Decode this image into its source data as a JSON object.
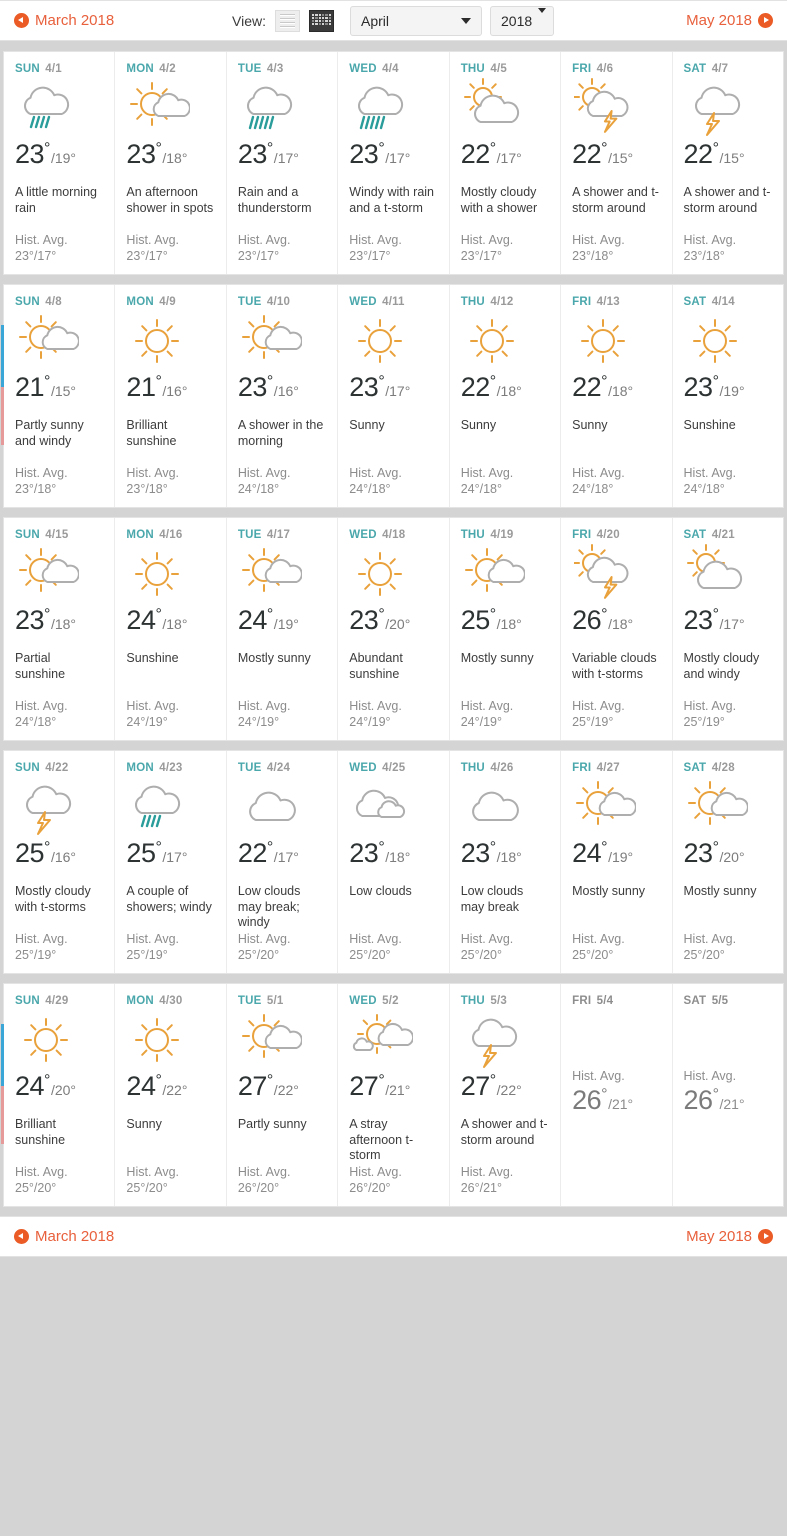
{
  "header": {
    "prev_label": "March 2018",
    "next_label": "May 2018",
    "view_label": "View:",
    "view_list_icon": "list-view-icon",
    "view_grid_icon": "calendar-grid-icon",
    "month_select": "April",
    "year_select": "2018",
    "accent_color": "#e8603c",
    "dayname_color": "#4aa7ab"
  },
  "footer": {
    "prev_label": "March 2018",
    "next_label": "May 2018"
  },
  "hist_prefix": "Hist. Avg.",
  "weeks": [
    {
      "marker": false,
      "days": [
        {
          "dow": "SUN",
          "date": "4/1",
          "icon": "rain",
          "hi": "23",
          "lo": "19",
          "phrase": "A little morning rain",
          "hist": "23°/17°",
          "active": true
        },
        {
          "dow": "MON",
          "date": "4/2",
          "icon": "sun-cloud",
          "hi": "23",
          "lo": "18",
          "phrase": "An afternoon shower in spots",
          "hist": "23°/17°",
          "active": true
        },
        {
          "dow": "TUE",
          "date": "4/3",
          "icon": "rain-heavy",
          "hi": "23",
          "lo": "17",
          "phrase": "Rain and a thunderstorm",
          "hist": "23°/17°",
          "active": true
        },
        {
          "dow": "WED",
          "date": "4/4",
          "icon": "rain-heavy",
          "hi": "23",
          "lo": "17",
          "phrase": "Windy with rain and a t-storm",
          "hist": "23°/17°",
          "active": true
        },
        {
          "dow": "THU",
          "date": "4/5",
          "icon": "sun-behind-cloud",
          "hi": "22",
          "lo": "17",
          "phrase": "Mostly cloudy with a shower",
          "hist": "23°/17°",
          "active": true
        },
        {
          "dow": "FRI",
          "date": "4/6",
          "icon": "sun-cloud-storm",
          "hi": "22",
          "lo": "15",
          "phrase": "A shower and t-storm around",
          "hist": "23°/18°",
          "active": true
        },
        {
          "dow": "SAT",
          "date": "4/7",
          "icon": "cloud-storm",
          "hi": "22",
          "lo": "15",
          "phrase": "A shower and t-storm around",
          "hist": "23°/18°",
          "active": true
        }
      ]
    },
    {
      "marker": true,
      "days": [
        {
          "dow": "SUN",
          "date": "4/8",
          "icon": "sun-cloud",
          "hi": "21",
          "lo": "15",
          "phrase": "Partly sunny and windy",
          "hist": "23°/18°",
          "active": true
        },
        {
          "dow": "MON",
          "date": "4/9",
          "icon": "sun",
          "hi": "21",
          "lo": "16",
          "phrase": "Brilliant sunshine",
          "hist": "23°/18°",
          "active": true
        },
        {
          "dow": "TUE",
          "date": "4/10",
          "icon": "sun-cloud",
          "hi": "23",
          "lo": "16",
          "phrase": "A shower in the morning",
          "hist": "24°/18°",
          "active": true
        },
        {
          "dow": "WED",
          "date": "4/11",
          "icon": "sun",
          "hi": "23",
          "lo": "17",
          "phrase": "Sunny",
          "hist": "24°/18°",
          "active": true
        },
        {
          "dow": "THU",
          "date": "4/12",
          "icon": "sun",
          "hi": "22",
          "lo": "18",
          "phrase": "Sunny",
          "hist": "24°/18°",
          "active": true
        },
        {
          "dow": "FRI",
          "date": "4/13",
          "icon": "sun",
          "hi": "22",
          "lo": "18",
          "phrase": "Sunny",
          "hist": "24°/18°",
          "active": true
        },
        {
          "dow": "SAT",
          "date": "4/14",
          "icon": "sun",
          "hi": "23",
          "lo": "19",
          "phrase": "Sunshine",
          "hist": "24°/18°",
          "active": true
        }
      ]
    },
    {
      "marker": false,
      "days": [
        {
          "dow": "SUN",
          "date": "4/15",
          "icon": "sun-cloud",
          "hi": "23",
          "lo": "18",
          "phrase": "Partial sunshine",
          "hist": "24°/18°",
          "active": true
        },
        {
          "dow": "MON",
          "date": "4/16",
          "icon": "sun",
          "hi": "24",
          "lo": "18",
          "phrase": "Sunshine",
          "hist": "24°/19°",
          "active": true
        },
        {
          "dow": "TUE",
          "date": "4/17",
          "icon": "sun-cloud",
          "hi": "24",
          "lo": "19",
          "phrase": "Mostly sunny",
          "hist": "24°/19°",
          "active": true
        },
        {
          "dow": "WED",
          "date": "4/18",
          "icon": "sun",
          "hi": "23",
          "lo": "20",
          "phrase": "Abundant sunshine",
          "hist": "24°/19°",
          "active": true
        },
        {
          "dow": "THU",
          "date": "4/19",
          "icon": "sun-cloud",
          "hi": "25",
          "lo": "18",
          "phrase": "Mostly sunny",
          "hist": "24°/19°",
          "active": true
        },
        {
          "dow": "FRI",
          "date": "4/20",
          "icon": "sun-cloud-storm",
          "hi": "26",
          "lo": "18",
          "phrase": "Variable clouds with t-storms",
          "hist": "25°/19°",
          "active": true
        },
        {
          "dow": "SAT",
          "date": "4/21",
          "icon": "sun-behind-cloud",
          "hi": "23",
          "lo": "17",
          "phrase": "Mostly cloudy and windy",
          "hist": "25°/19°",
          "active": true
        }
      ]
    },
    {
      "marker": false,
      "days": [
        {
          "dow": "SUN",
          "date": "4/22",
          "icon": "cloud-storm",
          "hi": "25",
          "lo": "16",
          "phrase": "Mostly cloudy with t-storms",
          "hist": "25°/19°",
          "active": true
        },
        {
          "dow": "MON",
          "date": "4/23",
          "icon": "rain",
          "hi": "25",
          "lo": "17",
          "phrase": "A couple of showers; windy",
          "hist": "25°/19°",
          "active": true
        },
        {
          "dow": "TUE",
          "date": "4/24",
          "icon": "cloud",
          "hi": "22",
          "lo": "17",
          "phrase": "Low clouds may break; windy",
          "hist": "25°/20°",
          "active": true
        },
        {
          "dow": "WED",
          "date": "4/25",
          "icon": "cloud-multi",
          "hi": "23",
          "lo": "18",
          "phrase": "Low clouds",
          "hist": "25°/20°",
          "active": true
        },
        {
          "dow": "THU",
          "date": "4/26",
          "icon": "cloud",
          "hi": "23",
          "lo": "18",
          "phrase": "Low clouds may break",
          "hist": "25°/20°",
          "active": true
        },
        {
          "dow": "FRI",
          "date": "4/27",
          "icon": "sun-cloud",
          "hi": "24",
          "lo": "19",
          "phrase": "Mostly sunny",
          "hist": "25°/20°",
          "active": true
        },
        {
          "dow": "SAT",
          "date": "4/28",
          "icon": "sun-cloud",
          "hi": "23",
          "lo": "20",
          "phrase": "Mostly sunny",
          "hist": "25°/20°",
          "active": true
        }
      ]
    },
    {
      "marker": true,
      "days": [
        {
          "dow": "SUN",
          "date": "4/29",
          "icon": "sun",
          "hi": "24",
          "lo": "20",
          "phrase": "Brilliant sunshine",
          "hist": "25°/20°",
          "active": true
        },
        {
          "dow": "MON",
          "date": "4/30",
          "icon": "sun",
          "hi": "24",
          "lo": "22",
          "phrase": "Sunny",
          "hist": "25°/20°",
          "active": true
        },
        {
          "dow": "TUE",
          "date": "5/1",
          "icon": "sun-cloud",
          "hi": "27",
          "lo": "22",
          "phrase": "Partly sunny",
          "hist": "26°/20°",
          "active": true
        },
        {
          "dow": "WED",
          "date": "5/2",
          "icon": "sun-clouds",
          "hi": "27",
          "lo": "21",
          "phrase": "A stray afternoon t-storm",
          "hist": "26°/20°",
          "active": true
        },
        {
          "dow": "THU",
          "date": "5/3",
          "icon": "cloud-storm",
          "hi": "27",
          "lo": "22",
          "phrase": "A shower and t-storm around",
          "hist": "26°/21°",
          "active": true
        },
        {
          "dow": "FRI",
          "date": "5/4",
          "icon": "none",
          "hi": "26",
          "lo": "21",
          "phrase": "",
          "hist": "",
          "active": false
        },
        {
          "dow": "SAT",
          "date": "5/5",
          "icon": "none",
          "hi": "26",
          "lo": "21",
          "phrase": "",
          "hist": "",
          "active": false
        }
      ]
    }
  ]
}
